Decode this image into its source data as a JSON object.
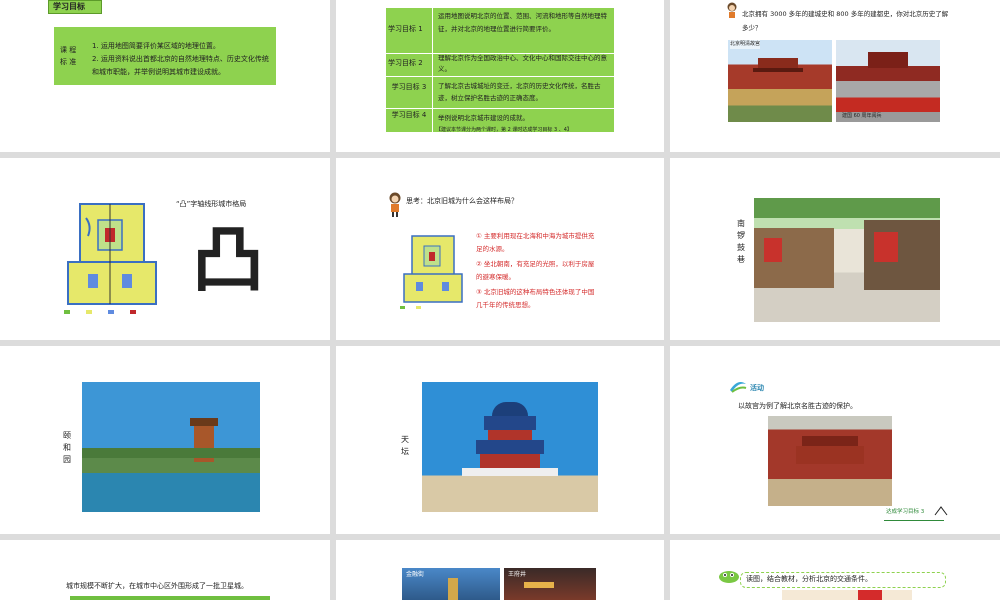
{
  "slide1": {
    "badge": "学习目标",
    "label_line1": "课 程",
    "label_line2": "标 准",
    "text1": "1. 运用地图简要评价某区域的地理位置。",
    "text2": "2. 运用资料说出首都北京的自然地理特点、历史文化传统和城市职能，并举例说明其城市建设成就。"
  },
  "slide2": {
    "rows": [
      {
        "label": "学习目标 1",
        "text": "运用地图说明北京的位置、范围、河流和地形等自然地理特征，并对北京的地理位置进行简要评价。"
      },
      {
        "label": "学习目标 2",
        "text": "理解北京作为全国政治中心、文化中心和国际交往中心的意义。"
      },
      {
        "label": "学习目标 3",
        "text": "了解北京古城城址的变迁，北京的历史文化传统，名胜古迹，树立保护名胜古迹的正确态度。"
      },
      {
        "label": "学习目标 4",
        "text": "举例说明北京城市建设的成就。"
      }
    ],
    "note": "【建议本节课分为两个课时，第 2 课时达成学习目标 3 、4】"
  },
  "slide3": {
    "question": "北京拥有 3000 多年的建城史和 800 多年的建都史，你对北京历史了解多少？",
    "caption1": "北京明清故宫",
    "caption2": "建国 60 周年阅兵"
  },
  "slide4": {
    "title": "“凸”字轴线形城市格局",
    "glyph": "凸"
  },
  "slide5": {
    "question": "思考：北京旧城为什么会这样布局？",
    "a1": "① 主要利用现在北海和中海为城市提供充足的水源。",
    "a2": "② 坐北朝南，有充足的光照，以利于房屋的避寒保暖。",
    "a3": "③ 北京旧城的这种布局特色还体现了中国几千年的传统思想。"
  },
  "slide6": {
    "label": "南锣鼓巷"
  },
  "slide7": {
    "label": "颐和园"
  },
  "slide8": {
    "label": "天坛"
  },
  "slide9": {
    "badge": "活动",
    "text": "以故宫为例了解北京名胜古迹的保护。",
    "footer": "达成学习目标 3"
  },
  "slide10": {
    "text": "城市规模不断扩大，在城市中心区外围形成了一批卫星城。"
  },
  "slide11": {
    "caption1": "金融街",
    "caption2": "王府井"
  },
  "slide12": {
    "text": "读图，结合教材，分析北京的交通条件。"
  },
  "colors": {
    "green": "#8ed24f",
    "red": "#d42b2b",
    "sky": "#3d96d6",
    "canvas": "#dcdcdc"
  }
}
